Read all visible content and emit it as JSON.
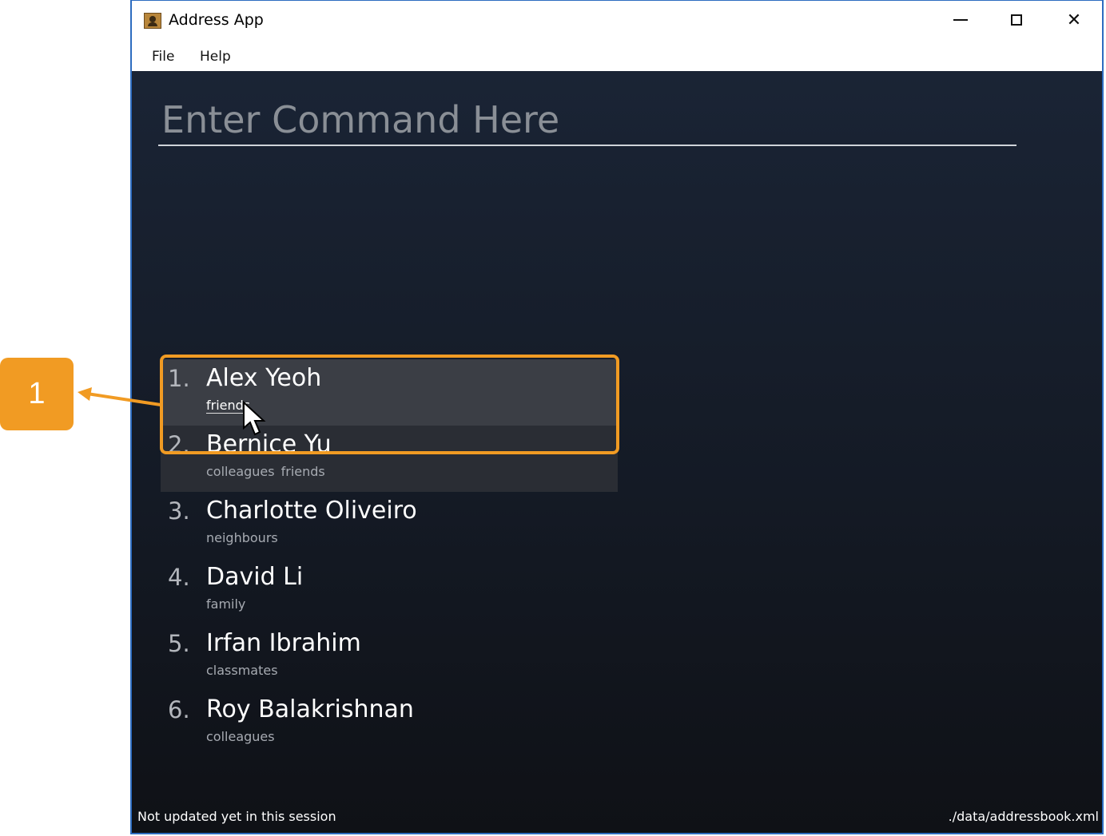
{
  "window": {
    "title": "Address App",
    "controls": {
      "minimize": "minimize",
      "maximize": "maximize",
      "close": "✕"
    }
  },
  "menu": {
    "items": [
      "File",
      "Help"
    ]
  },
  "command": {
    "placeholder": "Enter Command Here"
  },
  "persons": [
    {
      "index": "1.",
      "name": "Alex Yeoh",
      "tags": [
        "friends"
      ],
      "state": "selected"
    },
    {
      "index": "2.",
      "name": "Bernice Yu",
      "tags": [
        "colleagues",
        "friends"
      ],
      "state": "hovered"
    },
    {
      "index": "3.",
      "name": "Charlotte Oliveiro",
      "tags": [
        "neighbours"
      ],
      "state": "normal"
    },
    {
      "index": "4.",
      "name": "David Li",
      "tags": [
        "family"
      ],
      "state": "normal"
    },
    {
      "index": "5.",
      "name": "Irfan Ibrahim",
      "tags": [
        "classmates"
      ],
      "state": "normal"
    },
    {
      "index": "6.",
      "name": "Roy Balakrishnan",
      "tags": [
        "colleagues"
      ],
      "state": "normal"
    }
  ],
  "status": {
    "last_updated": "Not updated yet in this session",
    "file_path": "./data/addressbook.xml"
  },
  "annotation": {
    "label": "1",
    "color": "#f19b23"
  },
  "colors": {
    "accent": "#f19b23",
    "window_border": "#2d6cc0",
    "panel_bg": "#1a2435"
  }
}
